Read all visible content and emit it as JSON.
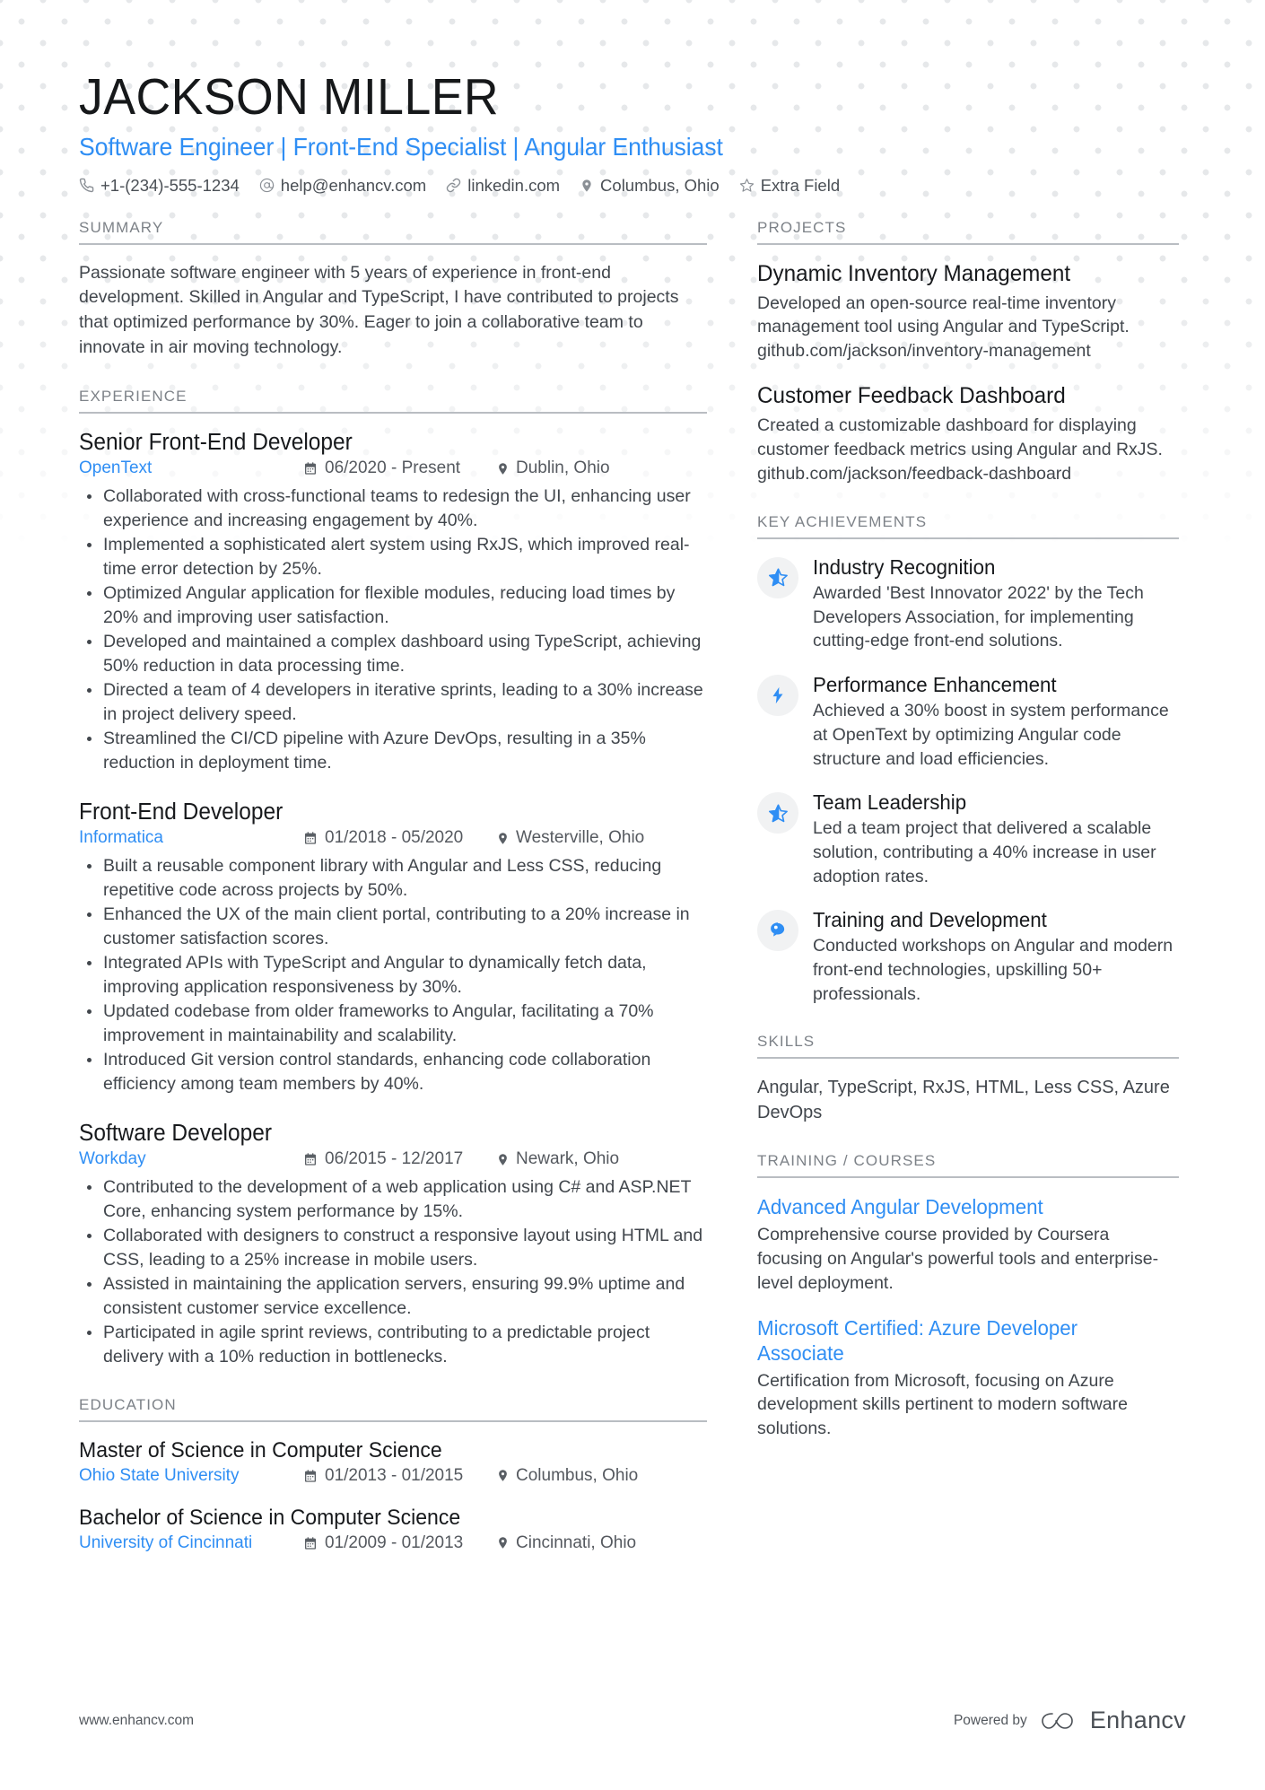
{
  "header": {
    "name": "JACKSON MILLER",
    "headline": "Software Engineer | Front-End Specialist | Angular Enthusiast",
    "contacts": [
      {
        "icon": "phone-icon",
        "text": "+1-(234)-555-1234"
      },
      {
        "icon": "email-icon",
        "text": "help@enhancv.com"
      },
      {
        "icon": "link-icon",
        "text": "linkedin.com"
      },
      {
        "icon": "location-icon",
        "text": "Columbus, Ohio"
      },
      {
        "icon": "star-icon",
        "text": "Extra Field"
      }
    ]
  },
  "summary": {
    "heading": "SUMMARY",
    "text": "Passionate software engineer with 5 years of experience in front-end development. Skilled in Angular and TypeScript, I have contributed to projects that optimized performance by 30%. Eager to join a collaborative team to innovate in air moving technology."
  },
  "experience": {
    "heading": "EXPERIENCE",
    "jobs": [
      {
        "title": "Senior Front-End Developer",
        "company": "OpenText",
        "dates": "06/2020 - Present",
        "location": "Dublin, Ohio",
        "bullets": [
          "Collaborated with cross-functional teams to redesign the UI, enhancing user experience and increasing engagement by 40%.",
          "Implemented a sophisticated alert system using RxJS, which improved real-time error detection by 25%.",
          "Optimized Angular application for flexible modules, reducing load times by 20% and improving user satisfaction.",
          "Developed and maintained a complex dashboard using TypeScript, achieving 50% reduction in data processing time.",
          "Directed a team of 4 developers in iterative sprints, leading to a 30% increase in project delivery speed.",
          "Streamlined the CI/CD pipeline with Azure DevOps, resulting in a 35% reduction in deployment time."
        ]
      },
      {
        "title": "Front-End Developer",
        "company": "Informatica",
        "dates": "01/2018 - 05/2020",
        "location": "Westerville, Ohio",
        "bullets": [
          "Built a reusable component library with Angular and Less CSS, reducing repetitive code across projects by 50%.",
          "Enhanced the UX of the main client portal, contributing to a 20% increase in customer satisfaction scores.",
          "Integrated APIs with TypeScript and Angular to dynamically fetch data, improving application responsiveness by 30%.",
          "Updated codebase from older frameworks to Angular, facilitating a 70% improvement in maintainability and scalability.",
          "Introduced Git version control standards, enhancing code collaboration efficiency among team members by 40%."
        ]
      },
      {
        "title": "Software Developer",
        "company": "Workday",
        "dates": "06/2015 - 12/2017",
        "location": "Newark, Ohio",
        "bullets": [
          "Contributed to the development of a web application using C# and ASP.NET Core, enhancing system performance by 15%.",
          "Collaborated with designers to construct a responsive layout using HTML and CSS, leading to a 25% increase in mobile users.",
          "Assisted in maintaining the application servers, ensuring 99.9% uptime and consistent customer service excellence.",
          "Participated in agile sprint reviews, contributing to a predictable project delivery with a 10% reduction in bottlenecks."
        ]
      }
    ]
  },
  "education": {
    "heading": "EDUCATION",
    "entries": [
      {
        "degree": "Master of Science in Computer Science",
        "school": "Ohio State University",
        "dates": "01/2013 - 01/2015",
        "location": "Columbus, Ohio"
      },
      {
        "degree": "Bachelor of Science in Computer Science",
        "school": "University of Cincinnati",
        "dates": "01/2009 - 01/2013",
        "location": "Cincinnati, Ohio"
      }
    ]
  },
  "projects": {
    "heading": "PROJECTS",
    "items": [
      {
        "title": "Dynamic Inventory Management",
        "description": "Developed an open-source real-time inventory management tool using Angular and TypeScript. github.com/jackson/inventory-management"
      },
      {
        "title": "Customer Feedback Dashboard",
        "description": "Created a customizable dashboard for displaying customer feedback metrics using Angular and RxJS. github.com/jackson/feedback-dashboard"
      }
    ]
  },
  "achievements": {
    "heading": "KEY ACHIEVEMENTS",
    "items": [
      {
        "icon": "star-badge-icon",
        "title": "Industry Recognition",
        "description": "Awarded 'Best Innovator 2022' by the Tech Developers Association, for implementing cutting-edge front-end solutions."
      },
      {
        "icon": "lightning-bolt-icon",
        "title": "Performance Enhancement",
        "description": "Achieved a 30% boost in system performance at OpenText by optimizing Angular code structure and load efficiencies."
      },
      {
        "icon": "star-badge-icon",
        "title": "Team Leadership",
        "description": "Led a team project that delivered a scalable solution, contributing a 40% increase in user adoption rates."
      },
      {
        "icon": "speech-bubble-icon",
        "title": "Training and Development",
        "description": "Conducted workshops on Angular and modern front-end technologies, upskilling 50+ professionals."
      }
    ]
  },
  "skills": {
    "heading": "SKILLS",
    "text": "Angular, TypeScript, RxJS, HTML, Less CSS, Azure DevOps"
  },
  "training": {
    "heading": "TRAINING / COURSES",
    "items": [
      {
        "title": "Advanced Angular Development",
        "description": "Comprehensive course provided by Coursera focusing on Angular's powerful tools and enterprise-level deployment."
      },
      {
        "title": "Microsoft Certified: Azure Developer Associate",
        "description": "Certification from Microsoft, focusing on Azure development skills pertinent to modern software solutions."
      }
    ]
  },
  "footer": {
    "url": "www.enhancv.com",
    "powered_by": "Powered by",
    "brand": "Enhancv"
  },
  "colors": {
    "accent": "#2f8ef4",
    "text": "#41464c",
    "heading": "#17191c",
    "muted": "#7d8288",
    "badge_bg": "#f1f2f3"
  }
}
